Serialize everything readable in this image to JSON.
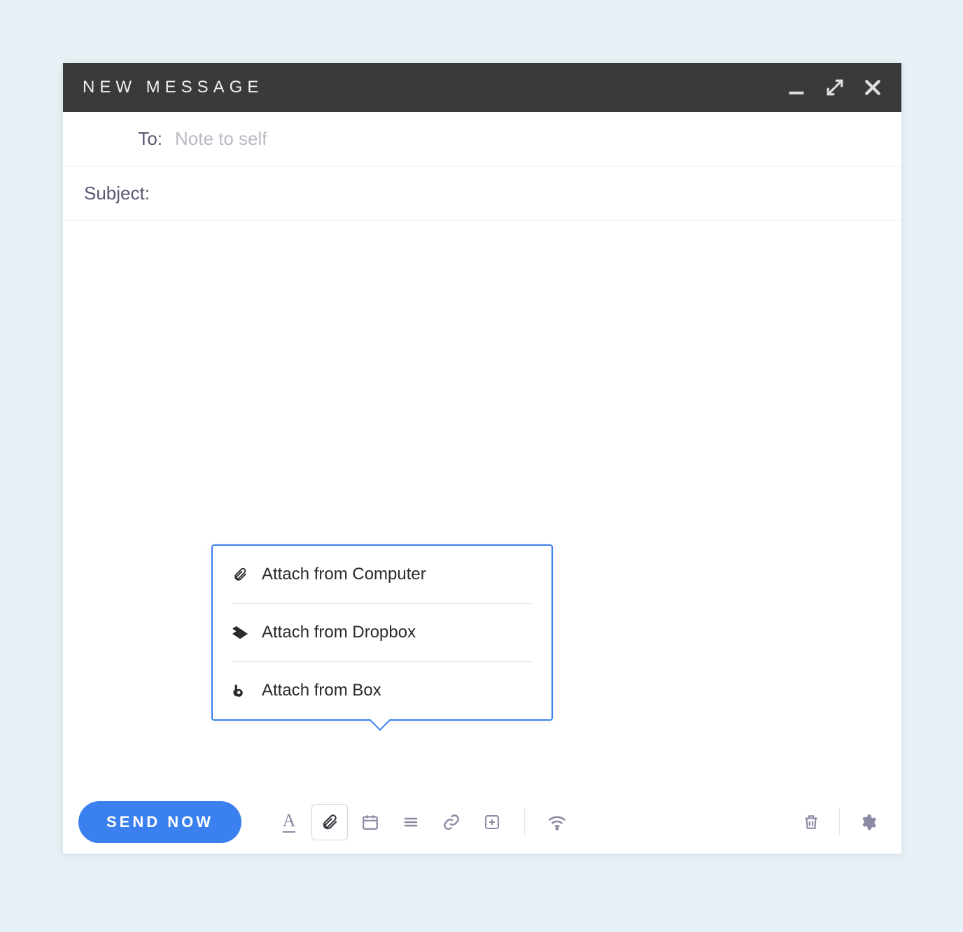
{
  "header": {
    "title": "NEW MESSAGE"
  },
  "fields": {
    "to_label": "To:",
    "to_placeholder": "Note to self",
    "subject_label": "Subject:"
  },
  "footer": {
    "send_label": "SEND NOW"
  },
  "attach_menu": {
    "computer": "Attach from Computer",
    "dropbox": "Attach from Dropbox",
    "box": "Attach from Box"
  }
}
